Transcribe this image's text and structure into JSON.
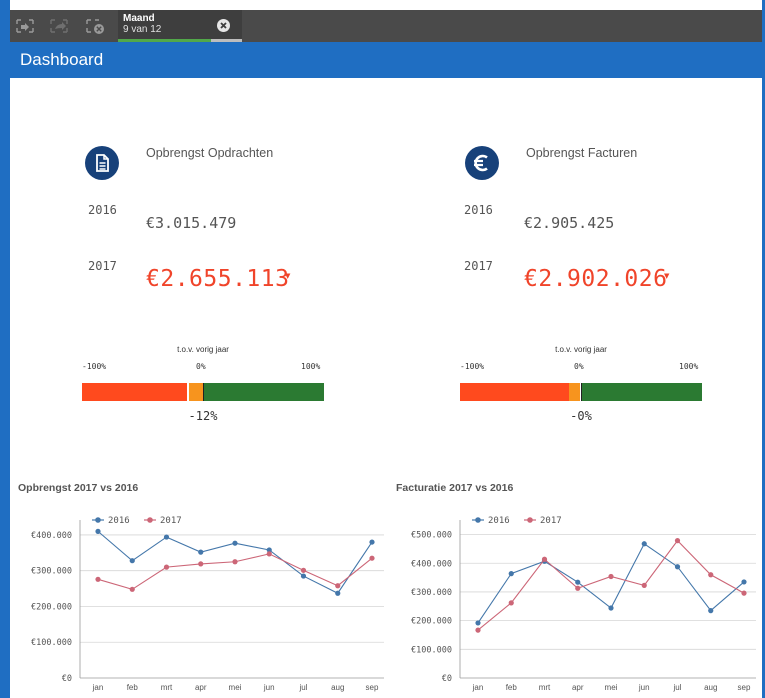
{
  "toolbar": {
    "icons": [
      "selections-back-icon",
      "selections-forward-icon",
      "clear-selections-icon",
      "close-icon"
    ],
    "selection": {
      "field": "Maand",
      "count": "9 van 12",
      "selected_fraction": 0.75
    }
  },
  "page": {
    "title": "Dashboard"
  },
  "kpis": [
    {
      "icon": "document-icon",
      "label": "Opbrengst Opdrachten",
      "year_prev": "2016",
      "value_prev": "€3.015.479",
      "year_cur": "2017",
      "value_cur": "€2.655.113",
      "trend_glyph": "▼",
      "gauge": {
        "title": "t.o.v. vorig jaar",
        "min_label": "-100%",
        "mid_label": "0%",
        "max_label": "100%",
        "value": -12,
        "value_label": "-12%"
      }
    },
    {
      "icon": "euro-icon",
      "label": "Opbrengst Facturen",
      "year_prev": "2016",
      "value_prev": "€2.905.425",
      "year_cur": "2017",
      "value_cur": "€2.902.026",
      "trend_glyph": "▼",
      "gauge": {
        "title": "t.o.v. vorig jaar",
        "min_label": "-100%",
        "mid_label": "0%",
        "max_label": "100%",
        "value": -0.1,
        "value_label": "-0%"
      }
    }
  ],
  "colors": {
    "accent": "#1f6ec2",
    "series_2016": "#4477aa",
    "series_2017": "#cc6677",
    "negative": "#f0442a"
  },
  "chart_data": [
    {
      "type": "line",
      "title": "Opbrengst 2017 vs 2016",
      "categories": [
        "jan",
        "feb",
        "mrt",
        "apr",
        "mei",
        "jun",
        "jul",
        "aug",
        "sep"
      ],
      "series": [
        {
          "name": "2016",
          "values": [
            410000,
            328000,
            394000,
            352000,
            377000,
            358000,
            285000,
            237000,
            380000
          ]
        },
        {
          "name": "2017",
          "values": [
            276000,
            248000,
            310000,
            319000,
            325000,
            347000,
            301000,
            258000,
            335000
          ]
        }
      ],
      "yticks": [
        0,
        100000,
        200000,
        300000,
        400000
      ],
      "ytick_labels": [
        "€0",
        "€100.000",
        "€200.000",
        "€300.000",
        "€400.000"
      ],
      "ylim": [
        0,
        425000
      ],
      "legend": "top-left",
      "grid": true
    },
    {
      "type": "line",
      "title": "Facturatie 2017 vs 2016",
      "categories": [
        "jan",
        "feb",
        "mrt",
        "apr",
        "mei",
        "jun",
        "jul",
        "aug",
        "sep"
      ],
      "series": [
        {
          "name": "2016",
          "values": [
            192000,
            364000,
            407000,
            334000,
            244000,
            468000,
            388000,
            235000,
            335000
          ]
        },
        {
          "name": "2017",
          "values": [
            167000,
            262000,
            414000,
            313000,
            354000,
            323000,
            479000,
            360000,
            296000
          ]
        }
      ],
      "yticks": [
        0,
        100000,
        200000,
        300000,
        400000,
        500000
      ],
      "ytick_labels": [
        "€0",
        "€100.000",
        "€200.000",
        "€300.000",
        "€400.000",
        "€500.000"
      ],
      "ylim": [
        0,
        530000
      ],
      "legend": "top-left",
      "grid": true
    }
  ]
}
